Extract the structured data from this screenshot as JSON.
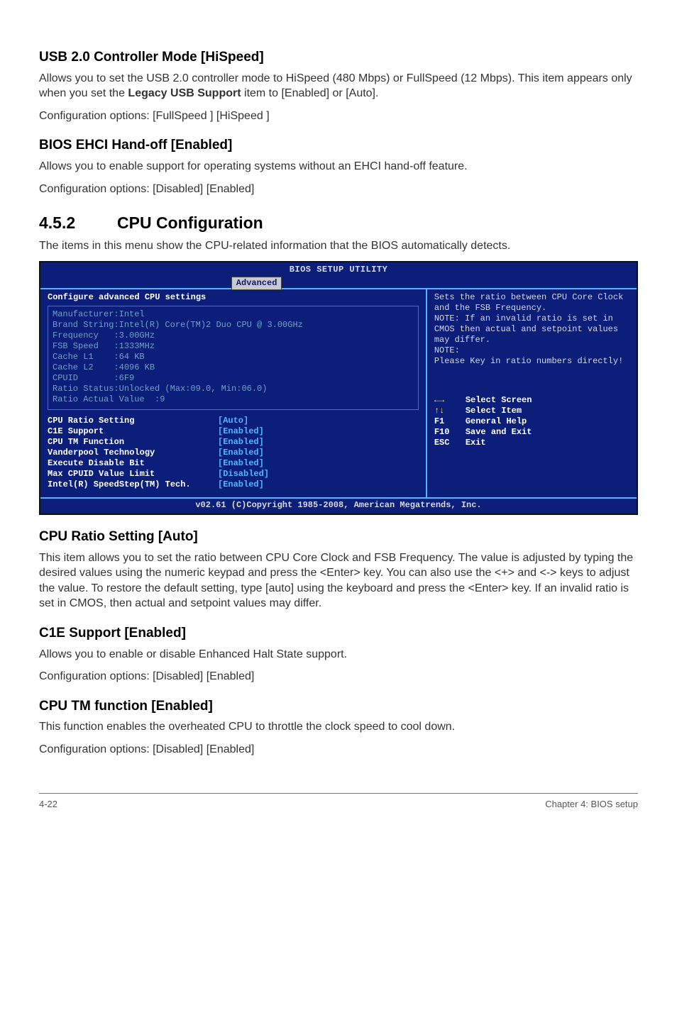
{
  "sections": {
    "usb": {
      "title": "USB 2.0 Controller Mode [HiSpeed]",
      "p1a": "Allows you to set the USB 2.0 controller mode to HiSpeed (480 Mbps) or FullSpeed (12 Mbps). This item appears only when you set the ",
      "p1b": "Legacy USB Support",
      "p1c": " item to [Enabled] or [Auto].",
      "p2": "Configuration options: [FullSpeed ] [HiSpeed ]"
    },
    "ehci": {
      "title": "BIOS EHCI Hand-off [Enabled]",
      "p1": "Allows you to enable support for operating systems without an EHCI hand-off feature.",
      "p2": "Configuration options: [Disabled] [Enabled]"
    },
    "cpu_config": {
      "num": "4.5.2",
      "title": "CPU Configuration",
      "intro": "The items in this menu show the CPU-related information that the BIOS automatically detects."
    },
    "cpu_ratio": {
      "title": "CPU Ratio Setting [Auto]",
      "p1": "This item allows you to set the ratio between CPU Core Clock and FSB Frequency. The value is adjusted by typing the desired values using the numeric keypad and press the <Enter> key. You can also use the <+> and <-> keys to adjust the value. To restore the default setting, type [auto] using the keyboard and press the <Enter> key. If an invalid ratio is set in CMOS, then actual and setpoint values may differ."
    },
    "c1e": {
      "title": "C1E Support [Enabled]",
      "p1": "Allows you to enable or disable Enhanced Halt State support.",
      "p2": "Configuration options: [Disabled] [Enabled]"
    },
    "cputm": {
      "title": "CPU TM function [Enabled]",
      "p1": "This function enables the overheated CPU to throttle the clock speed to cool down.",
      "p2": "Configuration options: [Disabled] [Enabled]"
    }
  },
  "bios": {
    "title": "BIOS SETUP UTILITY",
    "tab": "Advanced",
    "left_heading": "Configure advanced CPU settings",
    "info_lines": [
      "Manufacturer:Intel",
      "Brand String:Intel(R) Core(TM)2 Duo CPU @ 3.00GHz",
      "Frequency   :3.00GHz",
      "FSB Speed   :1333MHz",
      "Cache L1    :64 KB",
      "Cache L2    :4096 KB",
      "CPUID       :6F9",
      "Ratio Status:Unlocked (Max:09.0, Min:06.0)",
      "Ratio Actual Value  :9"
    ],
    "settings": [
      {
        "label": "CPU Ratio Setting",
        "value": "[Auto]"
      },
      {
        "label": "C1E Support",
        "value": "[Enabled]"
      },
      {
        "label": "CPU TM Function",
        "value": "[Enabled]"
      },
      {
        "label": "Vanderpool Technology",
        "value": "[Enabled]"
      },
      {
        "label": "Execute Disable Bit",
        "value": "[Enabled]"
      },
      {
        "label": "Max CPUID Value Limit",
        "value": "[Disabled]"
      },
      {
        "label": "Intel(R) SpeedStep(TM) Tech.",
        "value": "[Enabled]"
      }
    ],
    "help_text": "Sets the ratio between CPU Core Clock and the FSB Frequency.\nNOTE: If an invalid ratio is set in CMOS then actual and setpoint values may differ.\nNOTE:\nPlease Key in ratio numbers directly!",
    "nav": [
      {
        "key": "←→",
        "desc": "Select Screen",
        "cls": "arrow-lr"
      },
      {
        "key": "↑↓",
        "desc": "Select Item",
        "cls": "arrow-ud"
      },
      {
        "key": "F1",
        "desc": "General Help",
        "cls": ""
      },
      {
        "key": "F10",
        "desc": "Save and Exit",
        "cls": ""
      },
      {
        "key": "ESC",
        "desc": "Exit",
        "cls": ""
      }
    ],
    "footer": "v02.61 (C)Copyright 1985-2008, American Megatrends, Inc."
  },
  "chart_data": {
    "type": "table",
    "title": "Configure advanced CPU settings",
    "info": {
      "Manufacturer": "Intel",
      "Brand String": "Intel(R) Core(TM)2 Duo CPU @ 3.00GHz",
      "Frequency": "3.00GHz",
      "FSB Speed": "1333MHz",
      "Cache L1": "64 KB",
      "Cache L2": "4096 KB",
      "CPUID": "6F9",
      "Ratio Status": "Unlocked (Max:09.0, Min:06.0)",
      "Ratio Actual Value": "9"
    },
    "settings": {
      "CPU Ratio Setting": "Auto",
      "C1E Support": "Enabled",
      "CPU TM Function": "Enabled",
      "Vanderpool Technology": "Enabled",
      "Execute Disable Bit": "Enabled",
      "Max CPUID Value Limit": "Disabled",
      "Intel(R) SpeedStep(TM) Tech.": "Enabled"
    }
  },
  "footer": {
    "left": "4-22",
    "right": "Chapter 4: BIOS setup"
  }
}
